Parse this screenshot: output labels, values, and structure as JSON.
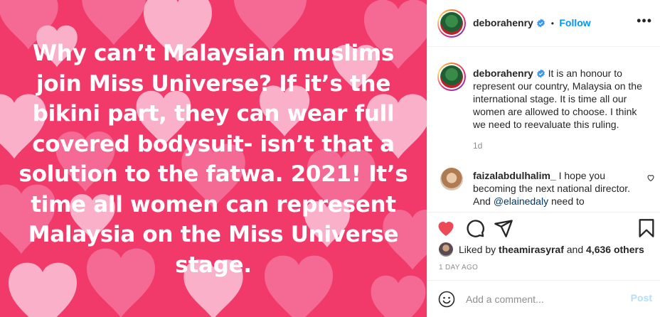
{
  "post": {
    "image_text": "Why can't Malaysian muslims join Miss Universe? If it's the bikini part, they can wear full covered bodysuit- isn't that a solution to the fatwa. 2021! It's time all women can represent Malaysia on the Miss Universe stage.",
    "image_lines": [
      "Why can’t Malaysian muslims",
      "join Miss Universe? If it’s the",
      "bikini part, they can wear full",
      "covered bodysuit- isn’t that a",
      "solution to the fatwa. 2021! It’s",
      "time all women can represent",
      "Malaysia on the Miss Universe",
      "stage."
    ],
    "colors": {
      "background": "#f23a6a",
      "heart_light": "#f9b0c8",
      "heart_mid": "#f56a94",
      "text": "#ffffff"
    }
  },
  "header": {
    "username": "deborahenry",
    "separator": "•",
    "follow_label": "Follow",
    "more_icon": "more-horizontal-icon"
  },
  "caption": {
    "username": "deborahenry",
    "text": "It is an honour to represent our country, Malaysia on the international stage. It is time all our women are allowed to choose. I think we need to reevaluate this ruling.",
    "time": "1d"
  },
  "comments": [
    {
      "username": "faizalabdulhalim_",
      "text_before": "I hope you becoming the next national director. And ",
      "mention": "@elainedaly",
      "text_after": " need to"
    }
  ],
  "actions": {
    "like_icon": "heart-filled-icon",
    "comment_icon": "comment-icon",
    "share_icon": "share-icon",
    "save_icon": "bookmark-icon"
  },
  "likes": {
    "prefix": "Liked by ",
    "user": "theamirasyraf",
    "middle": " and ",
    "count": "4,636 others"
  },
  "post_time": "1 DAY AGO",
  "add_comment": {
    "placeholder": "Add a comment...",
    "post_label": "Post"
  },
  "theme": {
    "accent": "#0095f6",
    "like_red": "#ed4956",
    "muted": "#8e8e8e",
    "verified": "#3897f0"
  }
}
